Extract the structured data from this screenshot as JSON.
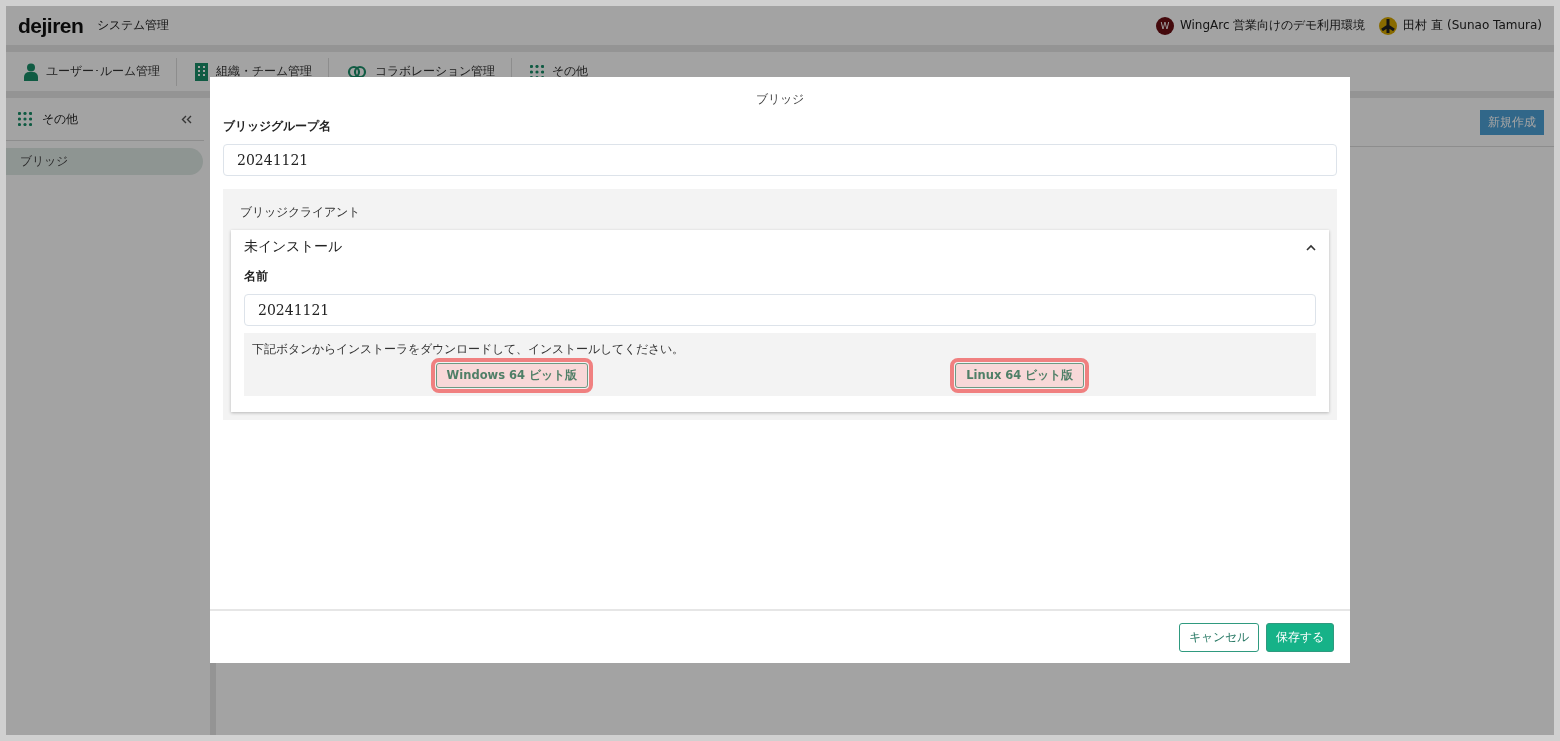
{
  "header": {
    "logo": "dejiren",
    "title": "システム管理",
    "tenant": {
      "initial": "W",
      "name": "WingArc 営業向けのデモ利用環境"
    },
    "user": {
      "name": "田村 直 (Sunao Tamura)"
    }
  },
  "nav": [
    {
      "kind": "person",
      "label": "ユーザー･ルーム管理"
    },
    {
      "kind": "building",
      "label": "組織・チーム管理"
    },
    {
      "kind": "link",
      "label": "コラボレーション管理"
    },
    {
      "kind": "grid",
      "label": "その他"
    }
  ],
  "sidebar": {
    "title": "その他",
    "items": [
      {
        "label": "ブリッジ",
        "selected": true
      }
    ]
  },
  "toolbar": {
    "new_button": "新規作成"
  },
  "dialog": {
    "title": "ブリッジ",
    "group_label": "ブリッジグループ名",
    "group_value": "20241121",
    "client_section": "ブリッジクライアント",
    "client": {
      "status": "未インストール",
      "expanded": true,
      "name_label": "名前",
      "name_value": "20241121",
      "instruction": "下記ボタンからインストーラをダウンロードして、インストールしてください。",
      "downloads": [
        {
          "label": "Windows 64 ビット版",
          "highlighted": true
        },
        {
          "label": "Linux 64 ビット版",
          "highlighted": true
        }
      ]
    },
    "buttons": [
      {
        "kind": "secondary",
        "label": "キャンセル"
      },
      {
        "kind": "primary",
        "label": "保存する"
      }
    ]
  }
}
